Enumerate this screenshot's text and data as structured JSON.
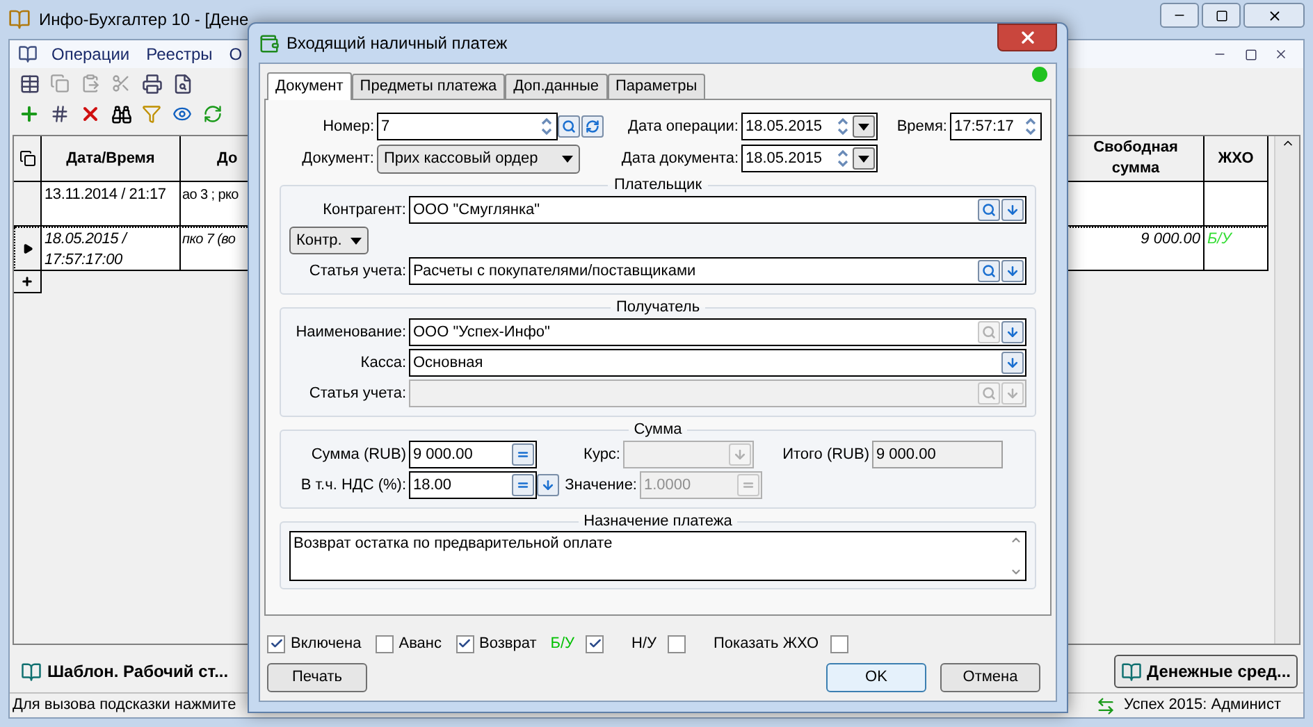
{
  "app": {
    "title": "Инфо-Бухгалтер 10 - [Дене",
    "menu": [
      "Операции",
      "Реестры",
      "О"
    ]
  },
  "table": {
    "columns": [
      "Дата/Время",
      "До",
      "Свободная сумма",
      "ЖХО"
    ],
    "rows": [
      {
        "date": "13.11.2014 / 21:17",
        "doc": "ао 3 ; рко",
        "free": "",
        "jho": "",
        "selected": false
      },
      {
        "date": "18.05.2015 / 17:57:17:00",
        "doc": "пко 7 (во",
        "free": "9 000.00",
        "jho": "Б/У",
        "selected": true
      }
    ]
  },
  "taskbar": [
    {
      "label": "Шаблон. Рабочий ст...",
      "selected": false
    },
    {
      "label": "Денежные сред...",
      "selected": true
    }
  ],
  "status_bar": {
    "hint": "Для вызова подсказки нажмите",
    "user": "Успех 2015: Админист"
  },
  "dialog": {
    "title": "Входящий наличный платеж",
    "status_dot": {
      "color": "#1fc21f"
    },
    "tabs": [
      {
        "label": "Документ",
        "selected": true
      },
      {
        "label": "Предметы платежа",
        "selected": false
      },
      {
        "label": "Доп.данные",
        "selected": false
      },
      {
        "label": "Параметры",
        "selected": false
      }
    ],
    "number_label": "Номер:",
    "number": "7",
    "op_date_label": "Дата операции:",
    "op_date": "18.05.2015",
    "time_label": "Время:",
    "time": "17:57:17",
    "doc_label": "Документ:",
    "doc_type": "Прих кассовый ордер",
    "doc_date_label": "Дата документа:",
    "doc_date": "18.05.2015",
    "payer": {
      "title": "Плательщик",
      "counterparty_label": "Контрагент:",
      "counterparty": "ООО \"Смуглянка\"",
      "kontr_button": "Контр.",
      "account_label": "Статья учета:",
      "account": "Расчеты с покупателями/поставщиками"
    },
    "recipient": {
      "title": "Получатель",
      "name_label": "Наименование:",
      "name": "ООО \"Успех-Инфо\"",
      "cash_label": "Касса:",
      "cash": "Основная",
      "account_label": "Статья учета:"
    },
    "sum": {
      "title": "Сумма",
      "amount_label": "Сумма (RUB)",
      "amount": "9 000.00",
      "rate_label": "Курс:",
      "total_label": "Итого (RUB)",
      "total": "9 000.00",
      "vat_label": "В т.ч. НДС (%):",
      "vat": "18.00",
      "value_label": "Значение:",
      "value": "1.0000"
    },
    "purpose": {
      "title": "Назначение платежа",
      "text": "Возврат остатка по предварительной оплате"
    },
    "checks": [
      {
        "kind": "box_first",
        "label": "Включена",
        "checked": true,
        "color": "#000000"
      },
      {
        "kind": "box_first",
        "label": "Аванс",
        "checked": false,
        "color": "#000000"
      },
      {
        "kind": "box_first",
        "label": "Возврат",
        "checked": true,
        "color": "#000000"
      },
      {
        "kind": "label_first",
        "label": "Б/У",
        "checked": true,
        "color": "#00c000"
      },
      {
        "kind": "label_first",
        "label": "Н/У",
        "checked": false,
        "color": "#000000"
      },
      {
        "kind": "label_first",
        "label": "Показать ЖХО",
        "checked": false,
        "color": "#000000"
      }
    ],
    "buttons": {
      "print": "Печать",
      "ok": "OK",
      "cancel": "Отмена"
    }
  }
}
